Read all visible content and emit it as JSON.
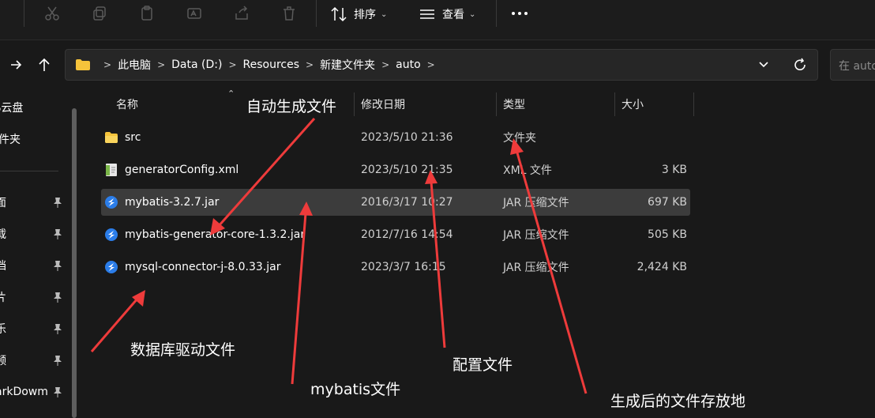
{
  "toolbar": {
    "icons": [
      "cut-icon",
      "copy-icon",
      "paste-icon",
      "rename-icon",
      "share-icon",
      "delete-icon"
    ],
    "sort_label": "排序",
    "view_label": "查看",
    "more_icon": "more-icon"
  },
  "breadcrumb": {
    "items": [
      "此电脑",
      "Data (D:)",
      "Resources",
      "新建文件夹",
      "auto"
    ]
  },
  "search": {
    "placeholder": "在 auto"
  },
  "sidebar": {
    "items": [
      {
        "label": "PS云盘",
        "pinned": false
      },
      {
        "label": "文件夹",
        "pinned": false
      },
      {
        "label": "面",
        "pinned": true
      },
      {
        "label": "载",
        "pinned": true
      },
      {
        "label": "档",
        "pinned": true
      },
      {
        "label": "片",
        "pinned": true
      },
      {
        "label": "乐",
        "pinned": true
      },
      {
        "label": "频",
        "pinned": true
      },
      {
        "label": "arkDowm",
        "pinned": true
      }
    ]
  },
  "columns": {
    "name": "名称",
    "date": "修改日期",
    "type": "类型",
    "size": "大小"
  },
  "files": [
    {
      "name": "src",
      "date": "2023/5/10 21:36",
      "type": "文件夹",
      "size": "",
      "icon": "folder-icon"
    },
    {
      "name": "generatorConfig.xml",
      "date": "2023/5/10 21:35",
      "type": "XML 文件",
      "size": "3 KB",
      "icon": "xml-file-icon"
    },
    {
      "name": "mybatis-3.2.7.jar",
      "date": "2016/3/17 10:27",
      "type": "JAR 压缩文件",
      "size": "697 KB",
      "icon": "jar-file-icon",
      "selected": true
    },
    {
      "name": "mybatis-generator-core-1.3.2.jar",
      "date": "2012/7/16 14:54",
      "type": "JAR 压缩文件",
      "size": "505 KB",
      "icon": "jar-file-icon"
    },
    {
      "name": "mysql-connector-j-8.0.33.jar",
      "date": "2023/3/7 16:15",
      "type": "JAR 压缩文件",
      "size": "2,424 KB",
      "icon": "jar-file-icon"
    }
  ],
  "annotations": {
    "auto_gen": "自动生成文件",
    "db_driver": "数据库驱动文件",
    "mybatis": "mybatis文件",
    "config": "配置文件",
    "output": "生成后的文件存放地",
    "arrow_color": "#ee3b3b"
  },
  "colors": {
    "background": "#191919",
    "selected_row": "#3c3c3c",
    "folder": "#f5c33b",
    "jar": "#2b7de9"
  }
}
